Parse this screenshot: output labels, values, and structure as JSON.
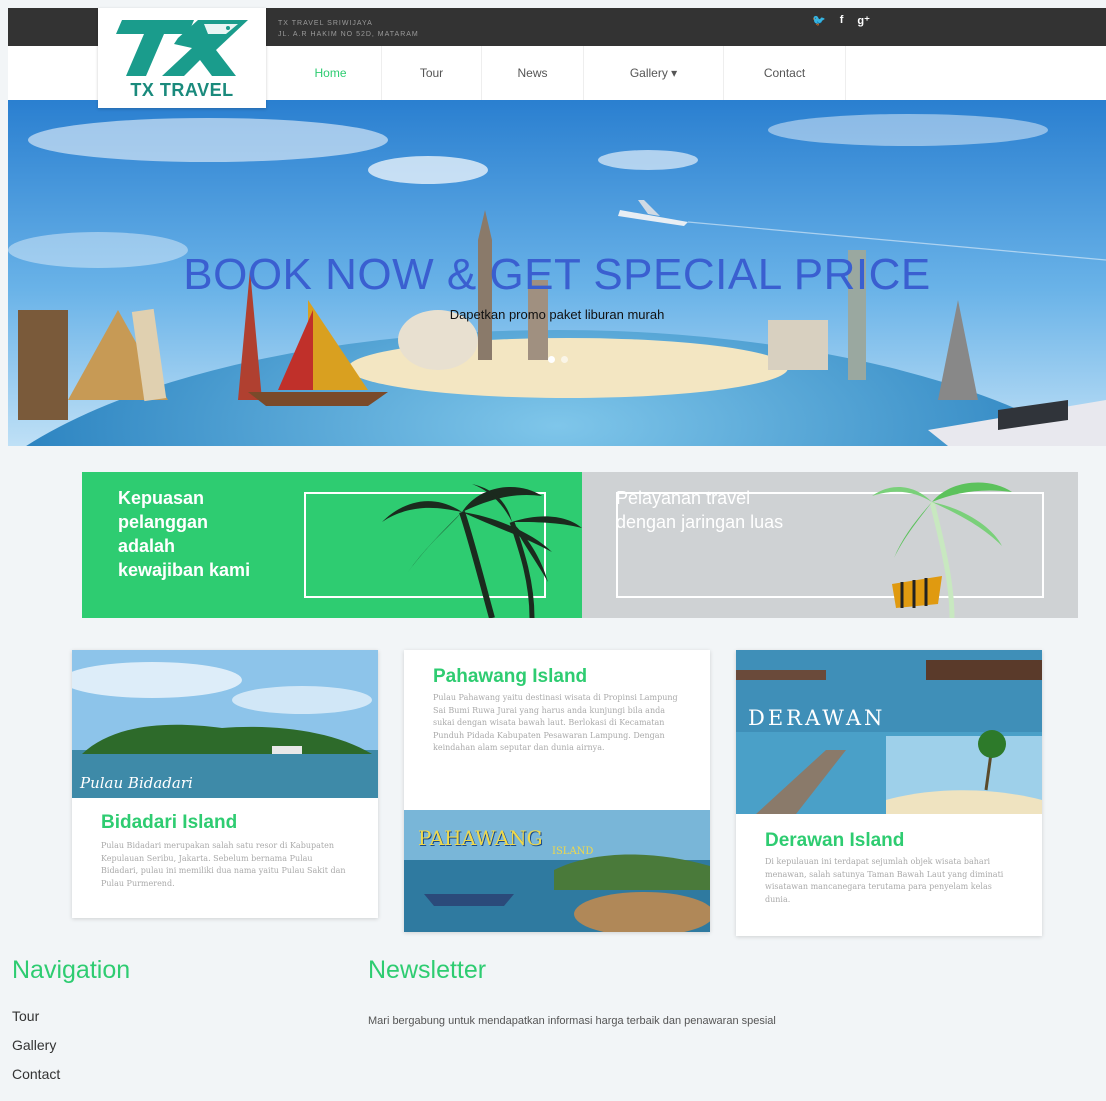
{
  "header": {
    "company": "TX TRAVEL SRIWIJAYA",
    "address": "JL. A.R HAKIM NO 52D, MATARAM",
    "social": {
      "twitter": "🐦",
      "facebook": "f",
      "googleplus": "g⁺"
    }
  },
  "logo": {
    "text": "TX TRAVEL",
    "brand_color": "#1a8a7c"
  },
  "nav": {
    "items": [
      {
        "label": "Home"
      },
      {
        "label": "Tour"
      },
      {
        "label": "News"
      },
      {
        "label": "Gallery  ▾"
      },
      {
        "label": "Contact"
      }
    ],
    "active_color": "#2ecc71"
  },
  "hero": {
    "title": "BOOK NOW & GET SPECIAL PRICE",
    "subtitle": "Dapetkan promo paket liburan murah"
  },
  "promos": [
    {
      "text": "Kepuasan pelanggan adalah kewajiban kami",
      "color": "#2ecc71"
    },
    {
      "text": "Pelayanan travel dengan jaringan luas",
      "color": "#cfd2d4"
    }
  ],
  "cards": [
    {
      "title": "Bidadari Island",
      "image_caption": "Pulau Bidadari",
      "text": "Pulau Bidadari merupakan salah satu resor di Kabupaten Kepulauan Seribu, Jakarta. Sebelum bernama Pulau Bidadari, pulau ini memiliki dua nama yaitu Pulau Sakit dan Pulau Purmerend."
    },
    {
      "title": "Pahawang Island",
      "image_caption": "PAHAWANG",
      "image_caption_small": "ISLAND",
      "text": "Pulau Pahawang yaitu destinasi wisata di Propinsi Lampung Sai Bumi Ruwa Jurai yang harus anda kunjungi bila anda sukai dengan wisata bawah laut. Berlokasi di Kecamatan Punduh Pidada Kabupaten Pesawaran Lampung. Dengan keindahan alam seputar dan dunia airnya."
    },
    {
      "title": "Derawan Island",
      "image_caption": "DERAWAN",
      "text": "Di kepulauan ini terdapat sejumlah objek wisata bahari menawan, salah satunya Taman Bawah Laut yang diminati wisatawan mancanegara terutama para penyelam kelas dunia."
    }
  ],
  "footer": {
    "nav_title": "Navigation",
    "nav_links": [
      "Tour",
      "Gallery",
      "Contact"
    ],
    "newsletter_title": "Newsletter",
    "newsletter_text": "Mari bergabung untuk mendapatkan informasi harga terbaik dan penawaran spesial"
  }
}
